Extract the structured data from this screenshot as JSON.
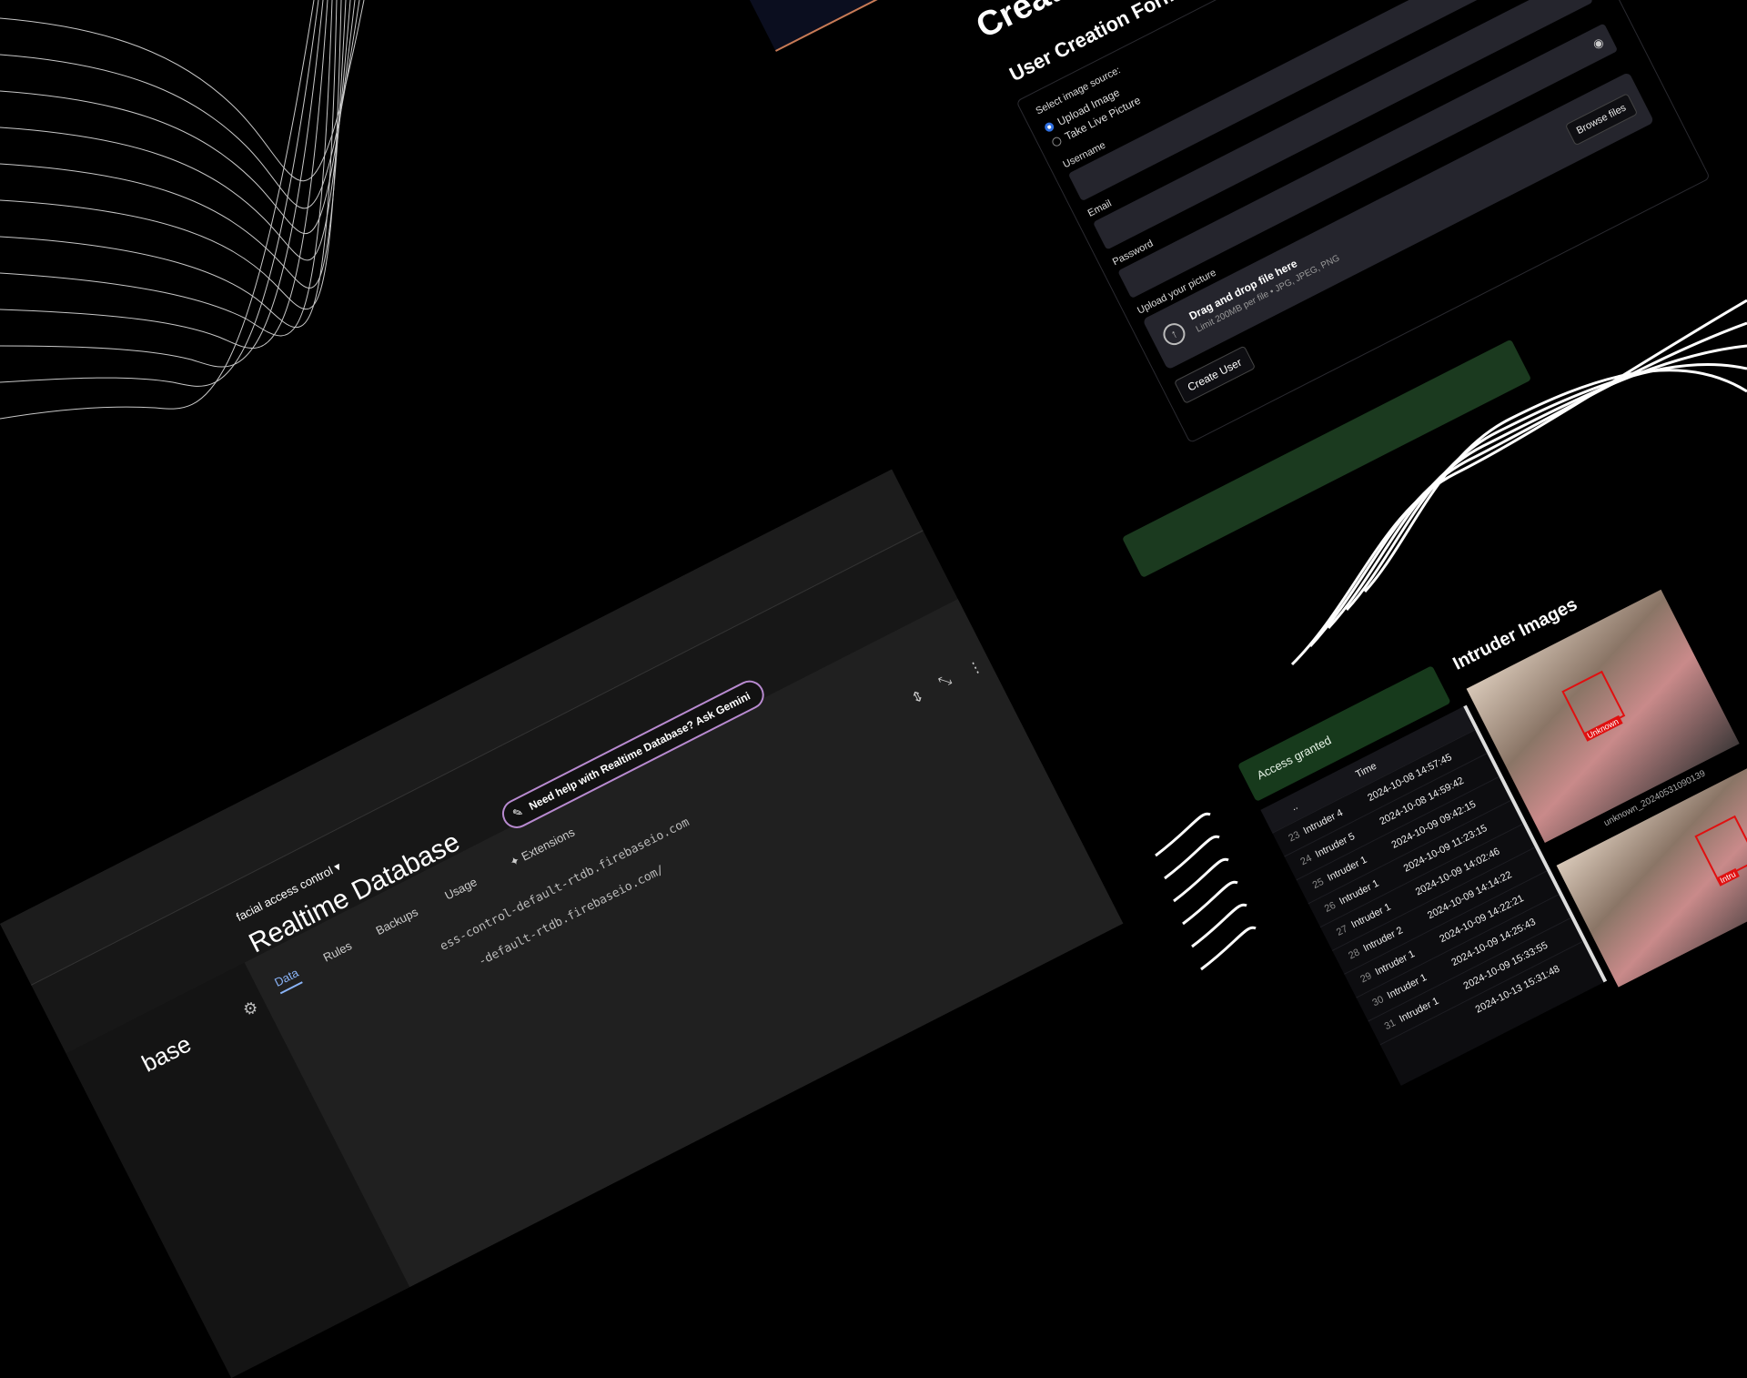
{
  "form": {
    "title": "Create User D",
    "subtitle": "User Creation Form",
    "source_label": "Select image source:",
    "option_upload": "Upload Image",
    "option_live": "Take Live Picture",
    "username_label": "Username",
    "email_label": "Email",
    "password_label": "Password",
    "upload_label": "Upload your picture",
    "browse_label": "Browse files",
    "drop_title": "Drag and drop file here",
    "drop_hint": "Limit 200MB per file • JPG, JPEG, PNG",
    "create_label": "Create User",
    "eye_icon": "eye-icon",
    "cloud_icon": "cloud-upload-icon"
  },
  "log": {
    "banner": "Access granted",
    "header_name": "..",
    "header_time": "Time",
    "rows": [
      {
        "idx": "23",
        "name": "Intruder 4",
        "time": "2024-10-08 14:57:45"
      },
      {
        "idx": "24",
        "name": "Intruder 5",
        "time": "2024-10-08 14:59:42"
      },
      {
        "idx": "25",
        "name": "Intruder 1",
        "time": "2024-10-09 09:42:15"
      },
      {
        "idx": "26",
        "name": "Intruder 1",
        "time": "2024-10-09 11:23:15"
      },
      {
        "idx": "27",
        "name": "Intruder 1",
        "time": "2024-10-09 14:02:46"
      },
      {
        "idx": "28",
        "name": "Intruder 2",
        "time": "2024-10-09 14:14:22"
      },
      {
        "idx": "29",
        "name": "Intruder 1",
        "time": "2024-10-09 14:22:21"
      },
      {
        "idx": "30",
        "name": "Intruder 1",
        "time": "2024-10-09 14:25:43"
      },
      {
        "idx": "31",
        "name": "Intruder 1",
        "time": "2024-10-09 15:33:55"
      },
      {
        "idx": "",
        "name": "",
        "time": "2024-10-13 15:31:48"
      }
    ],
    "intruder_title": "Intruder Images",
    "photo_tag": "Unknown",
    "photo_tag_2": "Intru",
    "photo_caption": "unknown_20240531090139"
  },
  "firebase": {
    "brand": "base",
    "project": "facial access control ▾",
    "title": "Realtime Database",
    "gemini": "Need help with Realtime Database? Ask Gemini",
    "tabs": [
      "Data",
      "Rules",
      "Backups",
      "Usage",
      "Extensions"
    ],
    "url_1": "ess-control-default-rtdb.firebaseio.com",
    "url_2": "-default-rtdb.firebaseio.com/",
    "colors": {
      "accent": "#8ab4f8",
      "gemini_border": "#b88ad0"
    }
  },
  "colors": {
    "background": "#000000",
    "radio_selected": "#2f6fe0",
    "success_green": "#173a1c",
    "face_box": "#e01010"
  }
}
